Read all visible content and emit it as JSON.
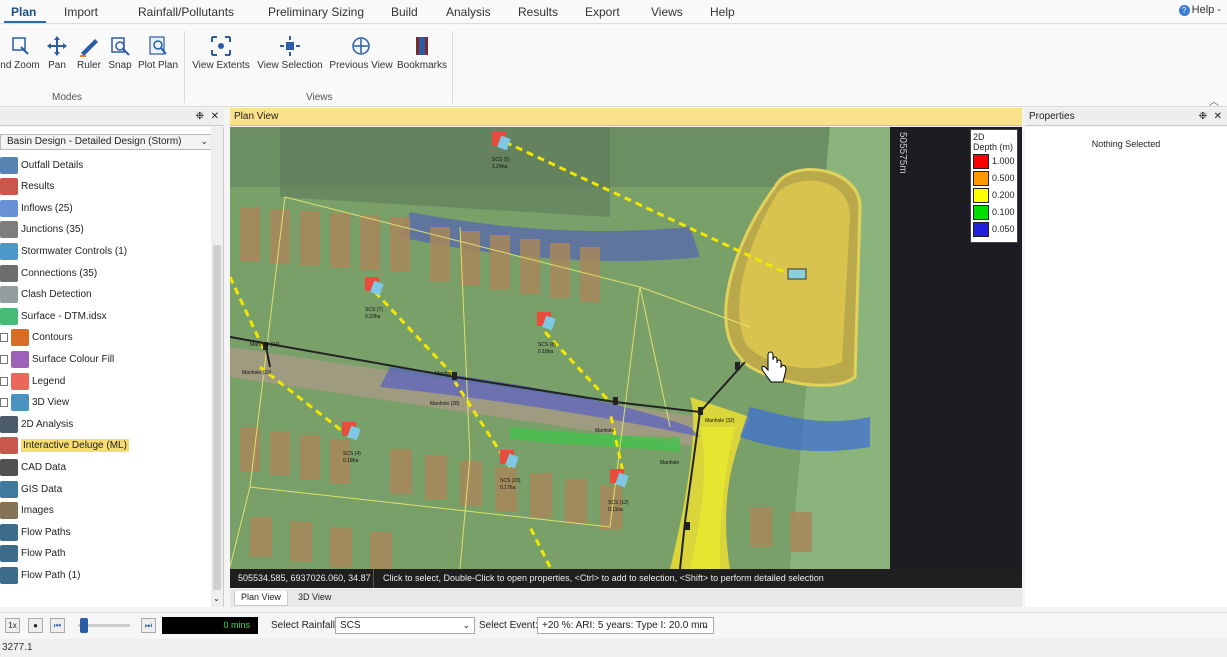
{
  "menu": {
    "items": [
      "Plan",
      "Import",
      "Rainfall/Pollutants",
      "Preliminary Sizing",
      "Build",
      "Analysis",
      "Results",
      "Export",
      "Views",
      "Help"
    ],
    "active": "Plan",
    "help_link": "Help -"
  },
  "ribbon": {
    "modes": {
      "buttons": [
        "nd Zoom",
        "Pan",
        "Ruler",
        "Snap",
        "Plot Plan"
      ],
      "label": "Modes"
    },
    "views": {
      "buttons": [
        "View Extents",
        "View Selection",
        "Previous View",
        "Bookmarks"
      ],
      "label": "Views"
    }
  },
  "left_panel": {
    "pin": "❉",
    "close": "✕"
  },
  "plan_view": {
    "title": "Plan View"
  },
  "properties": {
    "title": "Properties",
    "pin": "❉",
    "close": "✕",
    "empty": "Nothing Selected"
  },
  "tree": {
    "dropdown": "Basin Design - Detailed Design (Storm)",
    "items": [
      {
        "label": "Outfall Details",
        "icon": "outfall-icon",
        "color": "#3a6ea5"
      },
      {
        "label": "Results",
        "icon": "results-chart-icon",
        "color": "#c0392b"
      },
      {
        "label": "Inflows (25)",
        "icon": "inflow-icon",
        "color": "#4f7fcf"
      },
      {
        "label": "Junctions (35)",
        "icon": "junction-icon",
        "color": "#666666"
      },
      {
        "label": "Stormwater Controls (1)",
        "icon": "stormwater-icon",
        "color": "#2e86c1"
      },
      {
        "label": "Connections (35)",
        "icon": "connection-icon",
        "color": "#555555"
      },
      {
        "label": "Clash Detection",
        "icon": "clash-icon",
        "color": "#7f8c8d"
      },
      {
        "label": "Surface - DTM.idsx",
        "icon": "surface-icon",
        "color": "#27ae60"
      },
      {
        "label": "Contours",
        "icon": "contours-icon",
        "color": "#d35400",
        "checkbox": true
      },
      {
        "label": "Surface Colour Fill",
        "icon": "colour-fill-icon",
        "color": "#8e44ad",
        "checkbox": true
      },
      {
        "label": "Legend",
        "icon": "legend-icon",
        "color": "#e74c3c",
        "checkbox": true
      },
      {
        "label": "3D View",
        "icon": "3d-view-icon",
        "color": "#2980b9",
        "checkbox": true
      },
      {
        "label": "2D Analysis",
        "icon": "2d-analysis-icon",
        "color": "#2c3e50"
      },
      {
        "label": "Interactive Deluge (ML)",
        "icon": "deluge-icon",
        "color": "#c0392b",
        "highlight": true
      },
      {
        "label": "CAD Data",
        "icon": "cad-icon",
        "color": "#333333"
      },
      {
        "label": "GIS Data",
        "icon": "gis-icon",
        "color": "#1f618d"
      },
      {
        "label": "Images",
        "icon": "images-icon",
        "color": "#6e5b3a"
      },
      {
        "label": "Flow Paths",
        "icon": "flow-paths-icon",
        "color": "#1a5276"
      },
      {
        "label": "Flow Path",
        "icon": "flow-path-icon",
        "color": "#1a5276"
      },
      {
        "label": "Flow Path (1)",
        "icon": "flow-path-icon",
        "color": "#1a5276"
      }
    ]
  },
  "map": {
    "coord_label": "505575m",
    "legend": {
      "title": "2D",
      "subtitle": "Depth (m)",
      "items": [
        {
          "value": "1.000",
          "color": "#ff0000"
        },
        {
          "value": "0.500",
          "color": "#ff9900"
        },
        {
          "value": "0.200",
          "color": "#ffff00"
        },
        {
          "value": "0.100",
          "color": "#00dd00"
        },
        {
          "value": "0.050",
          "color": "#2222dd"
        }
      ]
    },
    "labels": {
      "scs5": "SCS (5)",
      "scs5_area": "1.24ha",
      "scs7": "SCS (7)",
      "scs7_area": "0.23ha",
      "scs8": "SCS (8)",
      "scs8_area": "0.18ha",
      "scs4": "SCS (4)",
      "scs4_area": "0.18ha",
      "scs23": "SCS (23)",
      "scs23_area": "0.17ha",
      "scs12": "SCS (12)",
      "scs12_area": "0.11ha",
      "mh34": "Manhole (34)",
      "mh33": "Manhole (33)",
      "mh28": "Manhole (28)",
      "mh32": "Manhole (32)",
      "mh": "Manhole"
    }
  },
  "status": {
    "coords": "505534.585, 6937026.060, 34.87",
    "hint": "Click to select, Double-Click to open properties, <Ctrl> to add to selection, <Shift> to perform detailed selection"
  },
  "tabs": [
    "Plan View",
    "3D View"
  ],
  "bottom": {
    "speed": "1x",
    "time": "0 mins",
    "rainfall_label": "Select Rainfall:",
    "rainfall_value": "SCS",
    "event_label": "Select Event:",
    "event_value": "+20 %: ARI: 5 years: Type I: 20.0 mm"
  },
  "footer": {
    "value": "3277.1"
  }
}
